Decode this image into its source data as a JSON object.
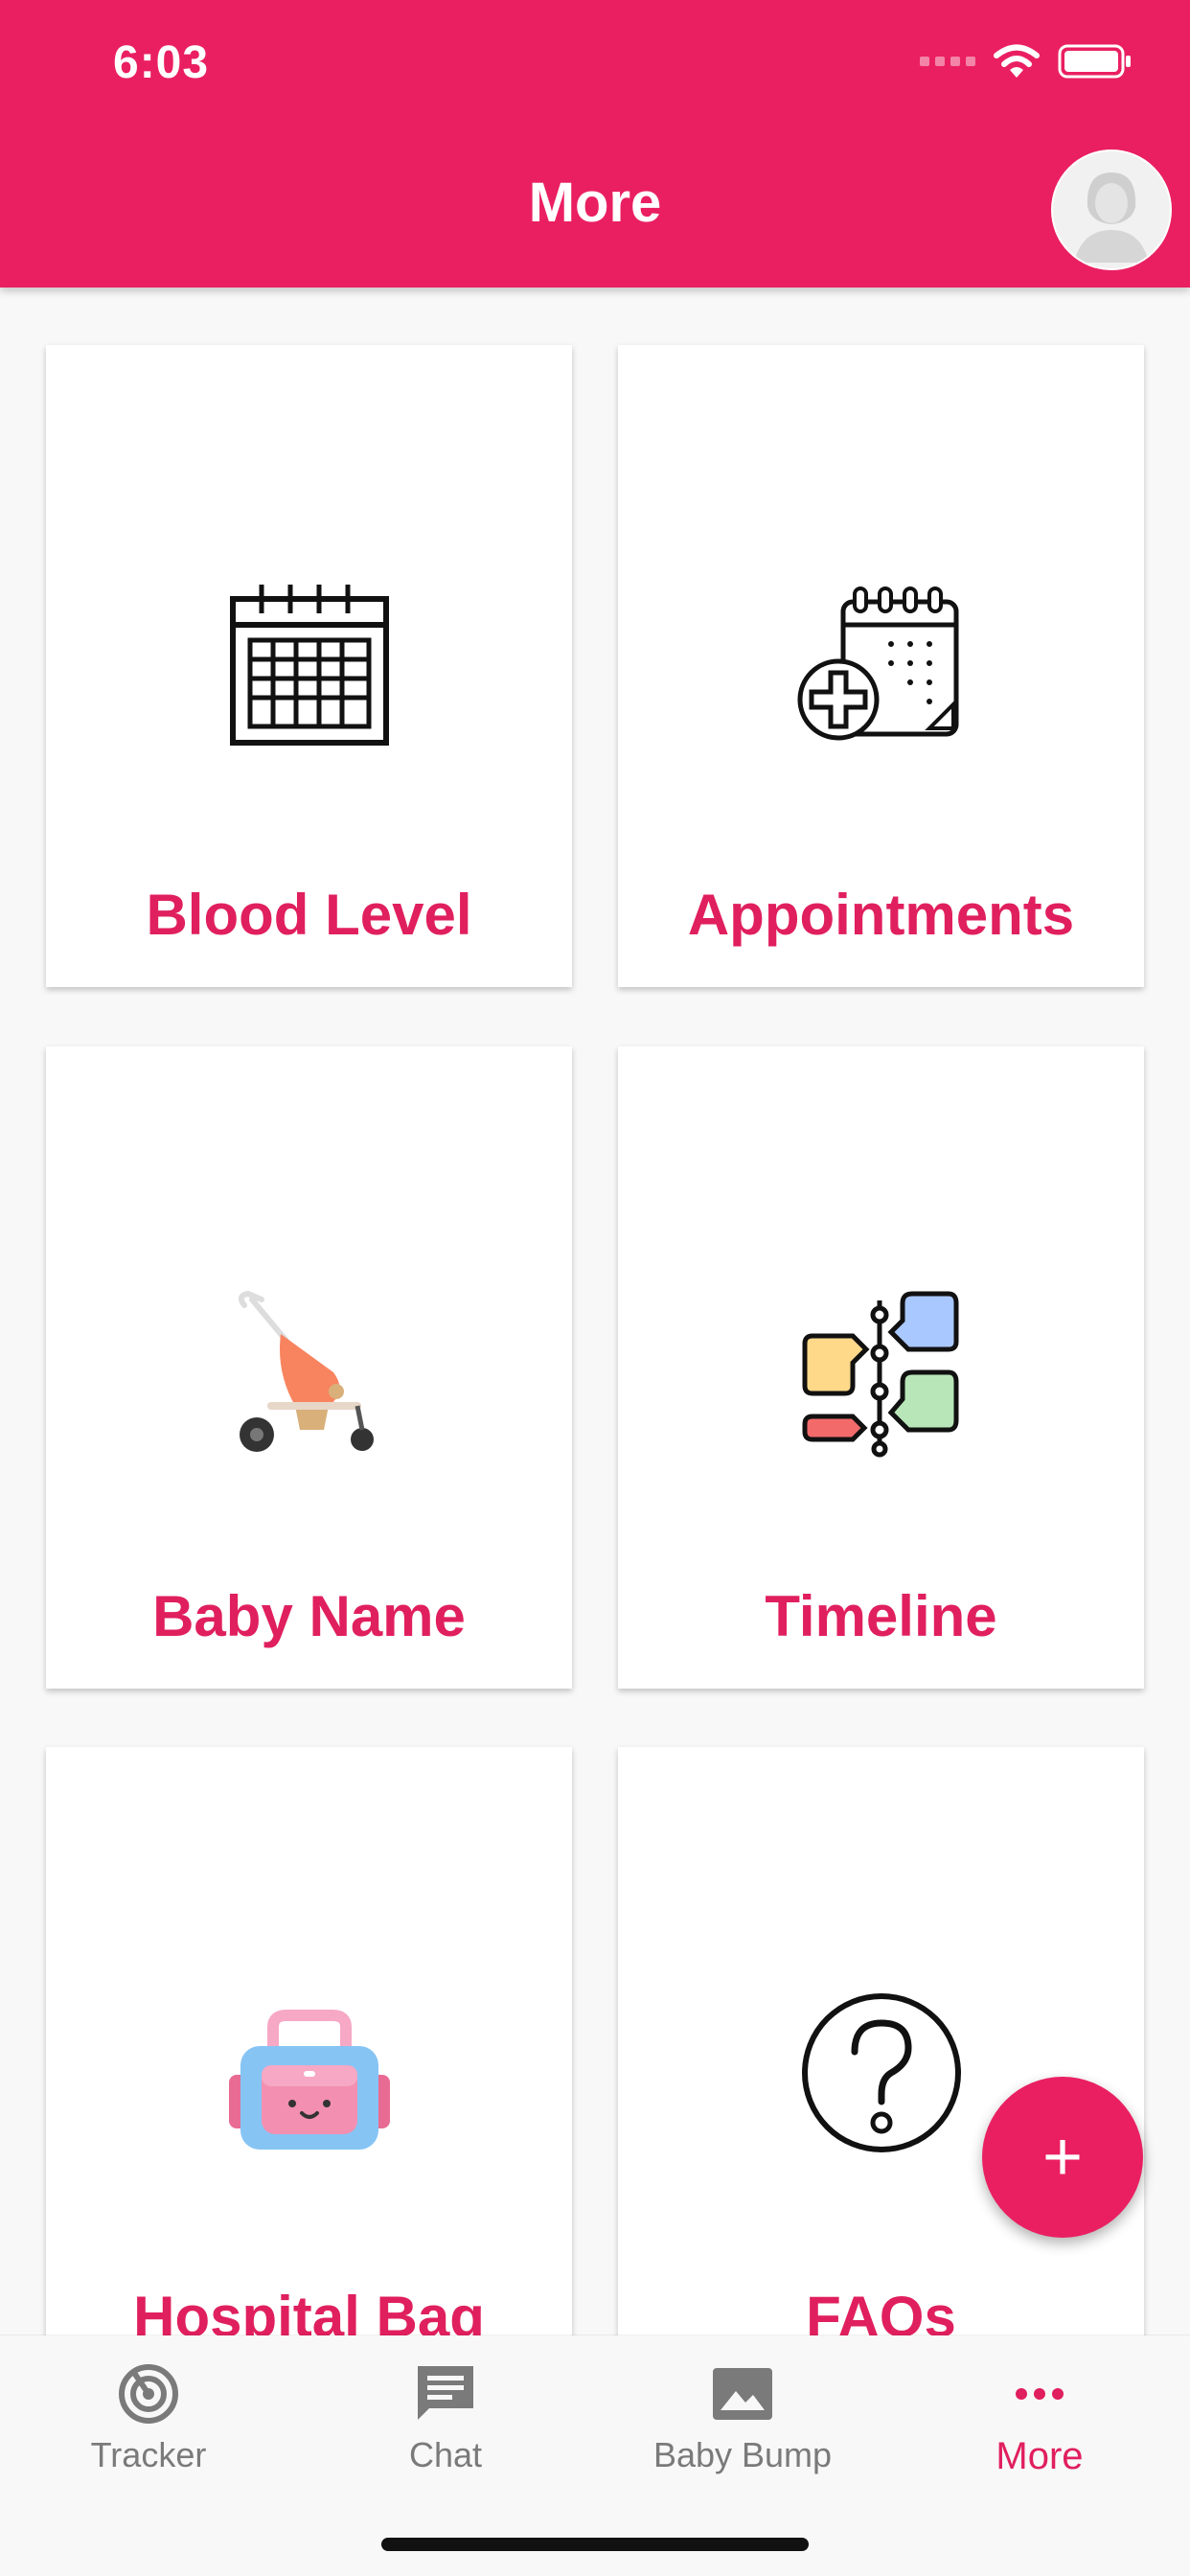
{
  "status_bar": {
    "time": "6:03"
  },
  "header": {
    "title": "More"
  },
  "cards": [
    {
      "label": "Blood Level",
      "icon": "calendar-icon"
    },
    {
      "label": "Appointments",
      "icon": "medical-appointment-icon"
    },
    {
      "label": "Baby Name",
      "icon": "stroller-icon"
    },
    {
      "label": "Timeline",
      "icon": "timeline-icon"
    },
    {
      "label": "Hospital Bag",
      "icon": "hospital-bag-icon"
    },
    {
      "label": "FAQs",
      "icon": "question-mark-icon"
    }
  ],
  "fab": {
    "label": "+"
  },
  "tabs": [
    {
      "label": "Tracker",
      "icon": "tracker-icon"
    },
    {
      "label": "Chat",
      "icon": "chat-icon"
    },
    {
      "label": "Baby Bump",
      "icon": "image-icon"
    },
    {
      "label": "More",
      "icon": "more-icon",
      "active": true
    }
  ],
  "colors": {
    "brand": "#ea1f62",
    "card_text": "#e01f5e",
    "tab_inactive": "#7a7a7a"
  }
}
